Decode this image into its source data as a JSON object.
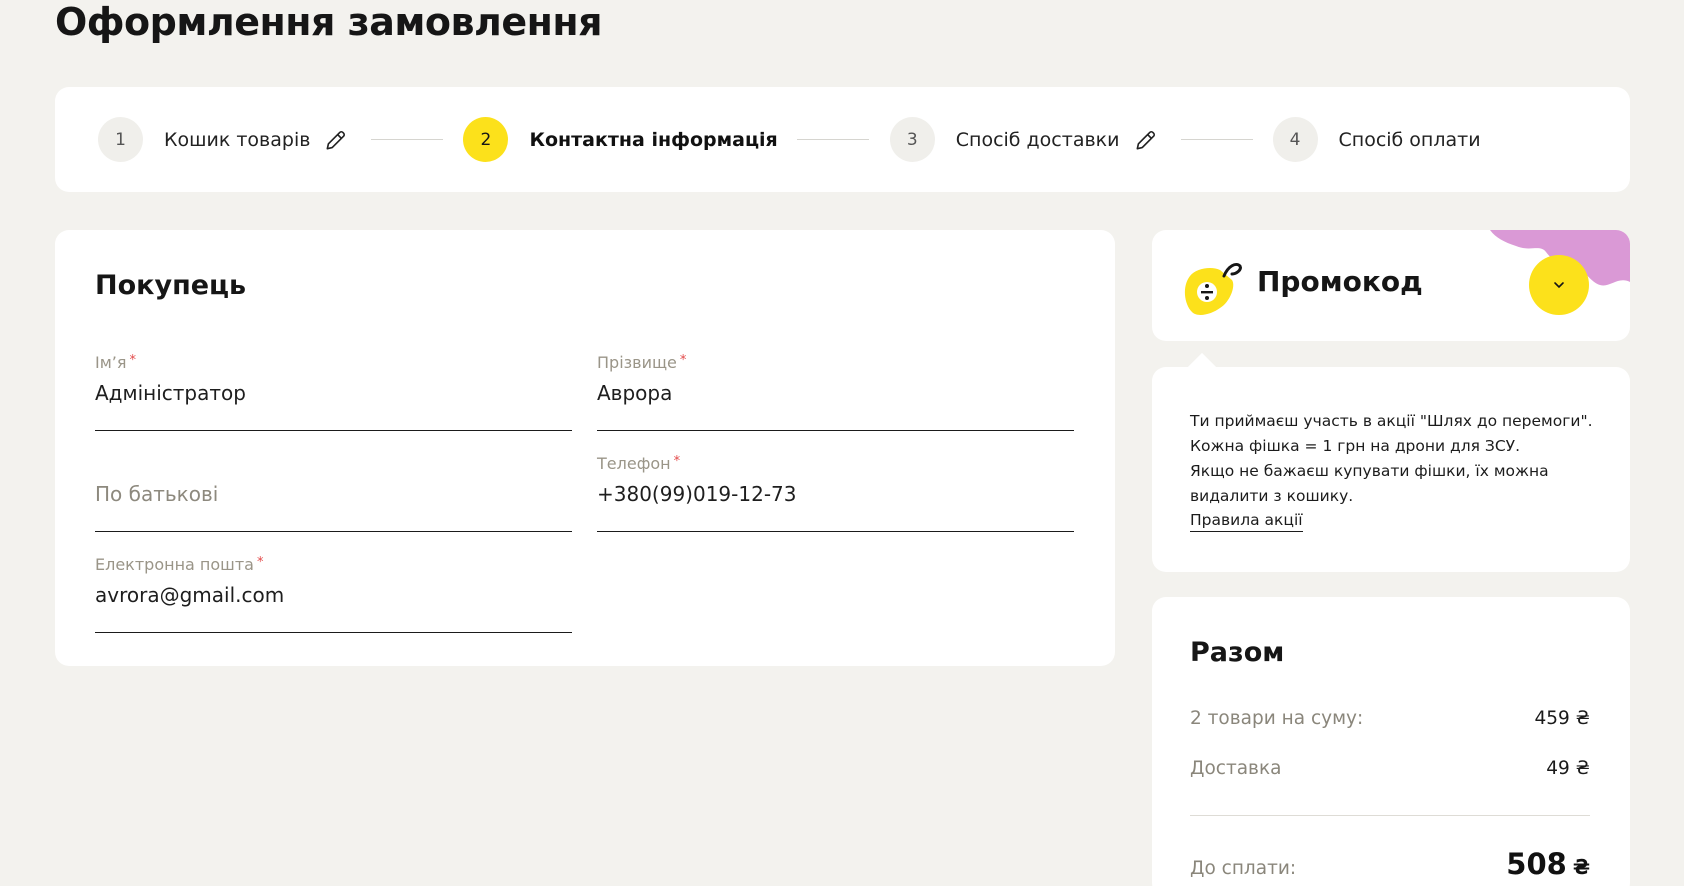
{
  "page": {
    "title": "Оформлення замовлення"
  },
  "stepper": {
    "steps": [
      {
        "num": "1",
        "label": "Кошик товарів",
        "editable": true,
        "active": false
      },
      {
        "num": "2",
        "label": "Контактна інформація",
        "editable": false,
        "active": true
      },
      {
        "num": "3",
        "label": "Спосіб доставки",
        "editable": true,
        "active": false
      },
      {
        "num": "4",
        "label": "Спосіб оплати",
        "editable": false,
        "active": false
      }
    ]
  },
  "buyer": {
    "title": "Покупець",
    "first_name": {
      "label": "Ім’я",
      "required_mark": "*",
      "value": "Адміністратор"
    },
    "last_name": {
      "label": "Прізвище",
      "required_mark": "*",
      "value": "Аврора"
    },
    "middle_name": {
      "placeholder": "По батькові",
      "value": ""
    },
    "phone": {
      "label": "Телефон",
      "required_mark": "*",
      "value": "+380(99)019-12-73"
    },
    "email": {
      "label": "Електронна пошта",
      "required_mark": "*",
      "value": "avrora@gmail.com"
    }
  },
  "promo": {
    "title": "Промокод",
    "icon": "price-tag-icon",
    "toggle_icon": "chevron-down-icon"
  },
  "info": {
    "lines": [
      "Ти приймаєш участь в акції \"Шлях до перемоги\".",
      "Кожна фішка = 1 грн на дрони для ЗСУ.",
      "Якщо не бажаєш купувати фішки, їх можна",
      "видалити з кошику."
    ],
    "link": "Правила акції"
  },
  "total": {
    "title": "Разом",
    "items_label": "2 товари на суму:",
    "items_value": "459 ₴",
    "delivery_label": "Доставка",
    "delivery_value": "49 ₴",
    "grand_label": "До сплати:",
    "grand_value": "508",
    "currency": "₴"
  },
  "colors": {
    "accent": "#fce11b",
    "background": "#f3f2ee",
    "blob": "#da99d6",
    "required": "#e34a4a"
  }
}
